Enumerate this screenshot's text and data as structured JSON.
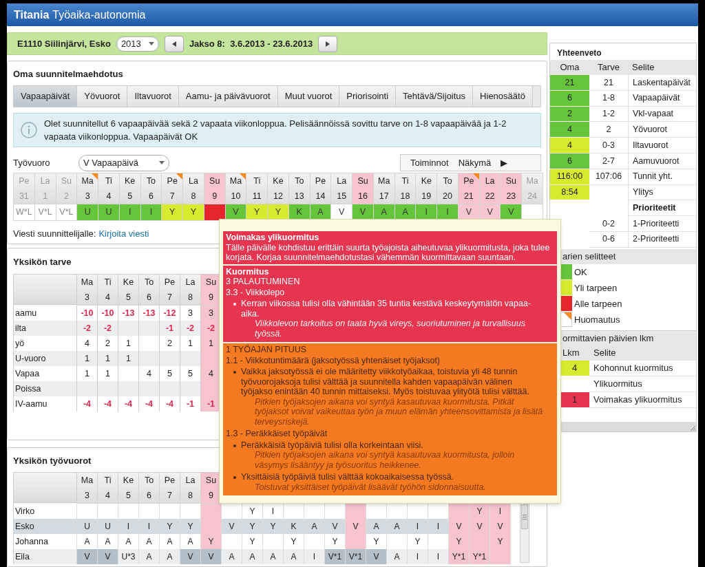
{
  "app": {
    "name": "Titania",
    "subtitle": "Työaika-autonomia"
  },
  "period_bar": {
    "employee": "E1110 Siilinjärvi, Esko",
    "year": "2013",
    "period": "Jakso 8:  3.6.2013 - 23.6.2013"
  },
  "plan": {
    "title": "Oma suunnitelmaehdotus",
    "tabs": [
      {
        "label": "Vapaapäivät",
        "selected": true
      },
      {
        "label": "Yövuorot",
        "selected": false
      },
      {
        "label": "Iltavuorot",
        "selected": false
      },
      {
        "label": "Aamu- ja päivävuorot",
        "selected": false
      },
      {
        "label": "Muut vuorot",
        "selected": false
      },
      {
        "label": "Priorisointi",
        "selected": false
      },
      {
        "label": "Tehtävä/Sijoitus",
        "selected": false
      },
      {
        "label": "Hienosäätö",
        "selected": false
      }
    ],
    "info": "Olet suunnitellut 6 vapaapäivää sekä 2 vapaata viikonloppua. Pelisäännöissä sovittu tarve on 1-8 vapaapäivää ja 1-2 vapaata viikonloppua. Vapaapäivät OK",
    "shift_label": "Työvuoro",
    "shift_select": "V Vapaapäivä",
    "toolbar": [
      "Toiminnot",
      "Näkymä",
      "▶"
    ],
    "message_label": "Viesti suunnittelijalle:",
    "message_link": "Kirjoita viesti"
  },
  "calendar": {
    "days": [
      {
        "weekday": "Pe",
        "day": "31",
        "shift": "W*L",
        "color": "#ffffff",
        "in_period": false,
        "holiday": false,
        "flag": false
      },
      {
        "weekday": "La",
        "day": "1",
        "shift": "V*L",
        "color": "#ffffff",
        "in_period": false,
        "holiday": false,
        "flag": false
      },
      {
        "weekday": "Su",
        "day": "2",
        "shift": "V*L",
        "color": "#ffffff",
        "in_period": false,
        "holiday": false,
        "flag": false
      },
      {
        "weekday": "Ma",
        "day": "3",
        "shift": "U",
        "color": "#66c43a",
        "in_period": true,
        "holiday": false,
        "flag": true
      },
      {
        "weekday": "Ti",
        "day": "4",
        "shift": "U",
        "color": "#66c43a",
        "in_period": true,
        "holiday": false,
        "flag": false
      },
      {
        "weekday": "Ke",
        "day": "5",
        "shift": "I",
        "color": "#66c43a",
        "in_period": true,
        "holiday": false,
        "flag": false
      },
      {
        "weekday": "To",
        "day": "6",
        "shift": "I",
        "color": "#66c43a",
        "in_period": true,
        "holiday": false,
        "flag": false
      },
      {
        "weekday": "Pe",
        "day": "7",
        "shift": "Y",
        "color": "#d8ea2e",
        "in_period": true,
        "holiday": false,
        "flag": true
      },
      {
        "weekday": "La",
        "day": "8",
        "shift": "Y",
        "color": "#d8ea2e",
        "in_period": true,
        "holiday": false,
        "flag": false
      },
      {
        "weekday": "Su",
        "day": "9",
        "color": "#e5272d",
        "in_period": true,
        "holiday": true,
        "flag": false
      },
      {
        "weekday": "Ma",
        "day": "10",
        "shift": "V",
        "color": "#66c43a",
        "in_period": true,
        "holiday": false,
        "flag": true
      },
      {
        "weekday": "Ti",
        "day": "11",
        "shift": "Y",
        "color": "#d8ea2e",
        "in_period": true,
        "holiday": false,
        "flag": false
      },
      {
        "weekday": "Ke",
        "day": "12",
        "shift": "Y",
        "color": "#d8ea2e",
        "in_period": true,
        "holiday": false,
        "flag": false
      },
      {
        "weekday": "To",
        "day": "13",
        "shift": "K",
        "color": "#66c43a",
        "in_period": true,
        "holiday": false,
        "flag": false
      },
      {
        "weekday": "Pe",
        "day": "14",
        "shift": "A",
        "color": "#66c43a",
        "in_period": true,
        "holiday": false,
        "flag": false
      },
      {
        "weekday": "La",
        "day": "15",
        "shift": "V",
        "color": "#ffffff",
        "in_period": true,
        "holiday": false,
        "flag": false
      },
      {
        "weekday": "Su",
        "day": "16",
        "shift": "V",
        "color": "#66c43a",
        "in_period": true,
        "holiday": true,
        "flag": false
      },
      {
        "weekday": "Ma",
        "day": "17",
        "shift": "A",
        "color": "#66c43a",
        "in_period": true,
        "holiday": false,
        "flag": false
      },
      {
        "weekday": "Ti",
        "day": "18",
        "shift": "A",
        "color": "#66c43a",
        "in_period": true,
        "holiday": false,
        "flag": false
      },
      {
        "weekday": "Ke",
        "day": "19",
        "shift": "I",
        "color": "#66c43a",
        "in_period": true,
        "holiday": false,
        "flag": false
      },
      {
        "weekday": "To",
        "day": "20",
        "shift": "I",
        "color": "#66c43a",
        "in_period": true,
        "holiday": false,
        "flag": false
      },
      {
        "weekday": "Pe",
        "day": "21",
        "shift": "V",
        "color": "#f7c6d1",
        "in_period": true,
        "holiday": true,
        "flag": true
      },
      {
        "weekday": "La",
        "day": "22",
        "shift": "V",
        "color": "#f7c6d1",
        "in_period": true,
        "holiday": true,
        "flag": false
      },
      {
        "weekday": "Su",
        "day": "23",
        "shift": "V",
        "color": "#66c43a",
        "in_period": true,
        "holiday": true,
        "flag": false
      },
      {
        "weekday": "Ma",
        "day": "24",
        "color": "#ffffff",
        "in_period": false,
        "holiday": false,
        "flag": false
      }
    ]
  },
  "needs": {
    "title": "Yksikön tarve",
    "columns": [
      {
        "weekday": "Ma",
        "day": "3"
      },
      {
        "weekday": "Ti",
        "day": "4"
      },
      {
        "weekday": "Ke",
        "day": "5"
      },
      {
        "weekday": "To",
        "day": "6"
      },
      {
        "weekday": "Pe",
        "day": "7"
      },
      {
        "weekday": "La",
        "day": "8"
      },
      {
        "weekday": "Su",
        "day": "9"
      }
    ],
    "rows": [
      {
        "label": "aamu",
        "cells": [
          {
            "text": "-10",
            "kind": "short"
          },
          {
            "text": "-10",
            "kind": "short"
          },
          {
            "text": "-13",
            "kind": "short"
          },
          {
            "text": "-13",
            "kind": "short"
          },
          {
            "text": "-12",
            "kind": "short"
          },
          {
            "text": "3",
            "kind": "plain"
          },
          {
            "text": "3",
            "kind": "plain"
          }
        ]
      },
      {
        "label": "ilta",
        "cells": [
          {
            "text": "-2",
            "kind": "short"
          },
          {
            "text": "-2",
            "kind": "short"
          },
          {
            "kind": "ok"
          },
          {
            "kind": "ok"
          },
          {
            "text": "-1",
            "kind": "short"
          },
          {
            "text": "-2",
            "kind": "short"
          },
          {
            "text": "-2",
            "kind": "short"
          }
        ]
      },
      {
        "label": "yö",
        "cells": [
          {
            "text": "4",
            "kind": "plain"
          },
          {
            "text": "2",
            "kind": "plain"
          },
          {
            "text": "1",
            "kind": "plain"
          },
          {
            "kind": "plain"
          },
          {
            "text": "2",
            "kind": "plain"
          },
          {
            "text": "1",
            "kind": "plain"
          },
          {
            "text": "1",
            "kind": "plain"
          }
        ]
      },
      {
        "label": "U-vuoro",
        "cells": [
          {
            "text": "1",
            "kind": "plain"
          },
          {
            "text": "1",
            "kind": "plain"
          },
          {
            "text": "1",
            "kind": "plain"
          },
          {
            "kind": "plain"
          },
          {
            "kind": "plain"
          },
          {
            "kind": "plain"
          },
          {
            "kind": "plain"
          }
        ]
      },
      {
        "label": "Vapaa",
        "cells": [
          {
            "text": "1",
            "kind": "plain"
          },
          {
            "text": "1",
            "kind": "plain"
          },
          {
            "kind": "plain"
          },
          {
            "text": "4",
            "kind": "plain"
          },
          {
            "text": "5",
            "kind": "plain"
          },
          {
            "text": "5",
            "kind": "plain"
          },
          {
            "text": "4",
            "kind": "plain"
          }
        ]
      },
      {
        "label": "Poissa",
        "cells": [
          {
            "kind": "plain"
          },
          {
            "kind": "plain"
          },
          {
            "kind": "plain"
          },
          {
            "kind": "plain"
          },
          {
            "kind": "plain"
          },
          {
            "kind": "plain"
          },
          {
            "kind": "plain"
          }
        ]
      },
      {
        "label": "IV-aamu",
        "cells": [
          {
            "text": "-4",
            "kind": "short"
          },
          {
            "text": "-4",
            "kind": "short"
          },
          {
            "text": "-4",
            "kind": "short"
          },
          {
            "text": "-4",
            "kind": "short"
          },
          {
            "text": "-4",
            "kind": "short"
          },
          {
            "text": "-1",
            "kind": "short"
          },
          {
            "text": "-1",
            "kind": "short"
          }
        ]
      }
    ]
  },
  "shifts": {
    "title": "Yksikön työvuorot",
    "columns": [
      {
        "weekday": "Ma",
        "day": "3"
      },
      {
        "weekday": "Ti",
        "day": "4"
      },
      {
        "weekday": "Ke",
        "day": "5"
      },
      {
        "weekday": "To",
        "day": "6"
      },
      {
        "weekday": "Pe",
        "day": "7"
      },
      {
        "weekday": "La",
        "day": "8"
      },
      {
        "weekday": "Su",
        "day": "9"
      }
    ],
    "rows": [
      {
        "name": "Virko",
        "selected": false,
        "cells": [
          {
            "shaded": false
          },
          {
            "shaded": false
          },
          {
            "shaded": false
          },
          {
            "shaded": false
          },
          {
            "shaded": false
          },
          {
            "shaded": false
          },
          {
            "shaded": false
          },
          {
            "shaded": false
          },
          {
            "text": "Y",
            "shaded": false
          },
          {
            "text": "I",
            "shaded": false
          },
          {
            "shaded": false
          },
          {
            "shaded": false
          },
          {
            "shaded": false
          },
          {
            "shaded": false
          },
          {
            "shaded": false
          },
          {
            "shaded": false
          },
          {
            "shaded": false
          },
          {
            "shaded": false
          },
          {
            "shaded": false
          },
          {
            "text": "Y",
            "shaded": false
          },
          {
            "text": "I",
            "shaded": false
          }
        ]
      },
      {
        "name": "Esko",
        "selected": true,
        "cells": [
          {
            "text": "U",
            "shaded": false
          },
          {
            "text": "U",
            "shaded": false
          },
          {
            "text": "I",
            "shaded": false
          },
          {
            "text": "I",
            "shaded": false
          },
          {
            "text": "Y",
            "shaded": false
          },
          {
            "text": "Y",
            "shaded": false
          },
          {
            "shaded": false
          },
          {
            "text": "V",
            "shaded": false
          },
          {
            "text": "Y",
            "shaded": false
          },
          {
            "text": "Y",
            "shaded": false
          },
          {
            "text": "K",
            "shaded": false
          },
          {
            "text": "A",
            "shaded": false
          },
          {
            "text": "V",
            "shaded": false
          },
          {
            "text": "V",
            "shaded": false
          },
          {
            "text": "A",
            "shaded": false
          },
          {
            "text": "A",
            "shaded": false
          },
          {
            "text": "I",
            "shaded": false
          },
          {
            "text": "I",
            "shaded": false
          },
          {
            "text": "V",
            "shaded": false
          },
          {
            "text": "V",
            "shaded": false
          },
          {
            "text": "V",
            "shaded": false
          }
        ]
      },
      {
        "name": "Johanna",
        "selected": false,
        "cells": [
          {
            "text": "A",
            "shaded": false
          },
          {
            "text": "A",
            "shaded": false
          },
          {
            "text": "A",
            "shaded": false
          },
          {
            "text": "A",
            "shaded": false
          },
          {
            "text": "A",
            "shaded": false
          },
          {
            "text": "A",
            "shaded": false
          },
          {
            "text": "Y",
            "shaded": false
          },
          {
            "shaded": false
          },
          {
            "text": "Y",
            "shaded": false
          },
          {
            "shaded": false
          },
          {
            "text": "Y",
            "shaded": false
          },
          {
            "shaded": false
          },
          {
            "text": "Y",
            "shaded": false
          },
          {
            "shaded": false
          },
          {
            "text": "Y",
            "shaded": false
          },
          {
            "shaded": false
          },
          {
            "text": "Y",
            "shaded": false
          },
          {
            "shaded": false
          },
          {
            "text": "Y",
            "shaded": false
          },
          {
            "shaded": false
          },
          {
            "text": "Y",
            "shaded": false
          }
        ]
      },
      {
        "name": "Eila",
        "selected": false,
        "cells": [
          {
            "text": "V",
            "shaded": true
          },
          {
            "text": "V",
            "shaded": true
          },
          {
            "text": "U*3",
            "shaded": false
          },
          {
            "text": "A",
            "shaded": false
          },
          {
            "text": "A",
            "shaded": false
          },
          {
            "text": "V",
            "shaded": true
          },
          {
            "text": "V",
            "shaded": true
          },
          {
            "text": "A",
            "shaded": false
          },
          {
            "text": "A",
            "shaded": false
          },
          {
            "text": "A",
            "shaded": false
          },
          {
            "text": "A",
            "shaded": false
          },
          {
            "text": "I",
            "shaded": false
          },
          {
            "text": "V*1",
            "shaded": true
          },
          {
            "text": "V*1",
            "shaded": true
          },
          {
            "text": "V",
            "shaded": true
          },
          {
            "text": "A",
            "shaded": false
          },
          {
            "text": "I",
            "shaded": false
          },
          {
            "text": "I",
            "shaded": false
          },
          {
            "text": "Y*1",
            "shaded": false
          },
          {
            "text": "Y*1",
            "shaded": false
          },
          {
            "shaded": false
          }
        ]
      }
    ]
  },
  "summary": {
    "title": "Yhteenveto",
    "columns": [
      "Oma",
      "Tarve",
      "Selite"
    ],
    "rows": [
      {
        "kind": "row",
        "oma": "21",
        "color": "#66c43a",
        "tarve": "21",
        "selite": "Laskentapäivät"
      },
      {
        "kind": "row",
        "oma": "6",
        "color": "#66c43a",
        "tarve": "1-8",
        "selite": "Vapaapäivät"
      },
      {
        "kind": "row",
        "oma": "2",
        "color": "#66c43a",
        "tarve": "1-2",
        "selite": "Vkl-vapaat"
      },
      {
        "kind": "row",
        "oma": "4",
        "color": "#66c43a",
        "tarve": "2",
        "selite": "Yövuorot"
      },
      {
        "kind": "row",
        "oma": "4",
        "color": "#d8ea2e",
        "tarve": "0-3",
        "selite": "Iltavuorot"
      },
      {
        "kind": "row",
        "oma": "6",
        "color": "#66c43a",
        "tarve": "2-7",
        "selite": "Aamuvuorot"
      },
      {
        "kind": "row",
        "oma": "116:00",
        "color": "#d8ea2e",
        "tarve": "107:06",
        "selite": "Tunnit yht."
      },
      {
        "kind": "row",
        "oma": "8:54",
        "color": "#d8ea2e",
        "selite": "Ylitys"
      },
      {
        "kind": "heading",
        "selite": "Prioriteetit"
      },
      {
        "kind": "row",
        "tarve": "0-2",
        "selite": "1-Prioriteetti"
      },
      {
        "kind": "row",
        "tarve": "0-6",
        "selite": "2-Prioriteetti"
      }
    ]
  },
  "legend": {
    "title": "arien selitteet",
    "items": [
      {
        "kind": "swatch",
        "color": "#66c43a",
        "label": "OK"
      },
      {
        "kind": "swatch",
        "color": "#d8ea2e",
        "label": "Yli tarpeen"
      },
      {
        "kind": "swatch",
        "color": "#e5272d",
        "label": "Alle tarpeen"
      },
      {
        "kind": "flag",
        "color": "#f28a1e",
        "label": "Huomautus"
      }
    ]
  },
  "load": {
    "title": "ormittavien päivien lkm",
    "columns": [
      "Lkm",
      "Selite"
    ],
    "rows": [
      {
        "count": "4",
        "color": "#d8ea2e",
        "label": "Kohonnut kuormitus"
      },
      {
        "label": "Ylikuormitus"
      },
      {
        "count": "1",
        "color": "#e8354f",
        "label": "Voimakas ylikuormitus"
      }
    ]
  },
  "tooltip": {
    "sections": [
      {
        "kind": "alert",
        "color": "#e8354f",
        "lines": [
          {
            "kind": "title",
            "text": "Voimakas ylikuormitus"
          },
          {
            "kind": "text",
            "text": "Tälle päivälle kohdistuu erittäin suurta työajoista aiheutuvaa ylikuormitusta, joka tulee korjata. Korjaa suunnitelmaehdotustasi vähemmän kuormittavaan suuntaan."
          }
        ]
      },
      {
        "kind": "alert",
        "color": "#e8354f",
        "lines": [
          {
            "kind": "title",
            "text": "Kuormitus"
          },
          {
            "kind": "heading",
            "text": "3 PALAUTUMINEN"
          },
          {
            "kind": "subheading",
            "text": "3.3 - Viikkolepo"
          },
          {
            "kind": "bullet",
            "text": "Kerran viikossa tulisi olla vähintään 35 tuntia kestävä keskeytymätön vapaa-aika.",
            "note": "Viikkolevon tarkoitus on taata hyvä vireys, suoriutuminen ja turvallisuus työssä."
          }
        ]
      },
      {
        "kind": "rule",
        "color": "#f47a22",
        "lines": [
          {
            "kind": "heading",
            "text": "1 TYÖAJAN PITUUS"
          },
          {
            "kind": "subheading",
            "text": "1.1 - Viikkotuntimäärä (jaksotyössä yhtenäiset työjaksot)"
          },
          {
            "kind": "bullet",
            "text": "Vaikka jaksotyössä ei ole määritetty viikkotyöaikaa, toistuvia yli 48 tunnin työvuorojaksoja tulisi välttää ja suunnitella kahden vapaapäivän välinen työjakso enintään 40 tunnin mittaiseksi. Myös toistuvaa ylityötä tulisi välttää.",
            "note": "Pitkien työjaksojen aikana voi syntyä kasautuvaa kuormitusta. Pitkät työjaksot voivat vaikeuttaa työn ja muun elämän yhteensovittamista ja lisätä terveysriskejä."
          },
          {
            "kind": "subheading",
            "text": "1.3 - Peräkkäiset työpäivät"
          },
          {
            "kind": "bullet",
            "text": "Peräkkäisiä työpäiviä tulisi olla korkeintaan viisi.",
            "note": "Pitkien työjaksojen aikana voi syntyä kasautuvaa kuormitusta, jolloin väsymys lisääntyy ja työsuoritus heikkenee."
          },
          {
            "kind": "bullet",
            "text": "Yksittäisiä työpäiviä tulisi välttää kokoaikaisessa työssä.",
            "note": "Toistuvat yksittäiset työpäivät lisäävät työhön sidonnaisuutta."
          }
        ]
      }
    ]
  }
}
